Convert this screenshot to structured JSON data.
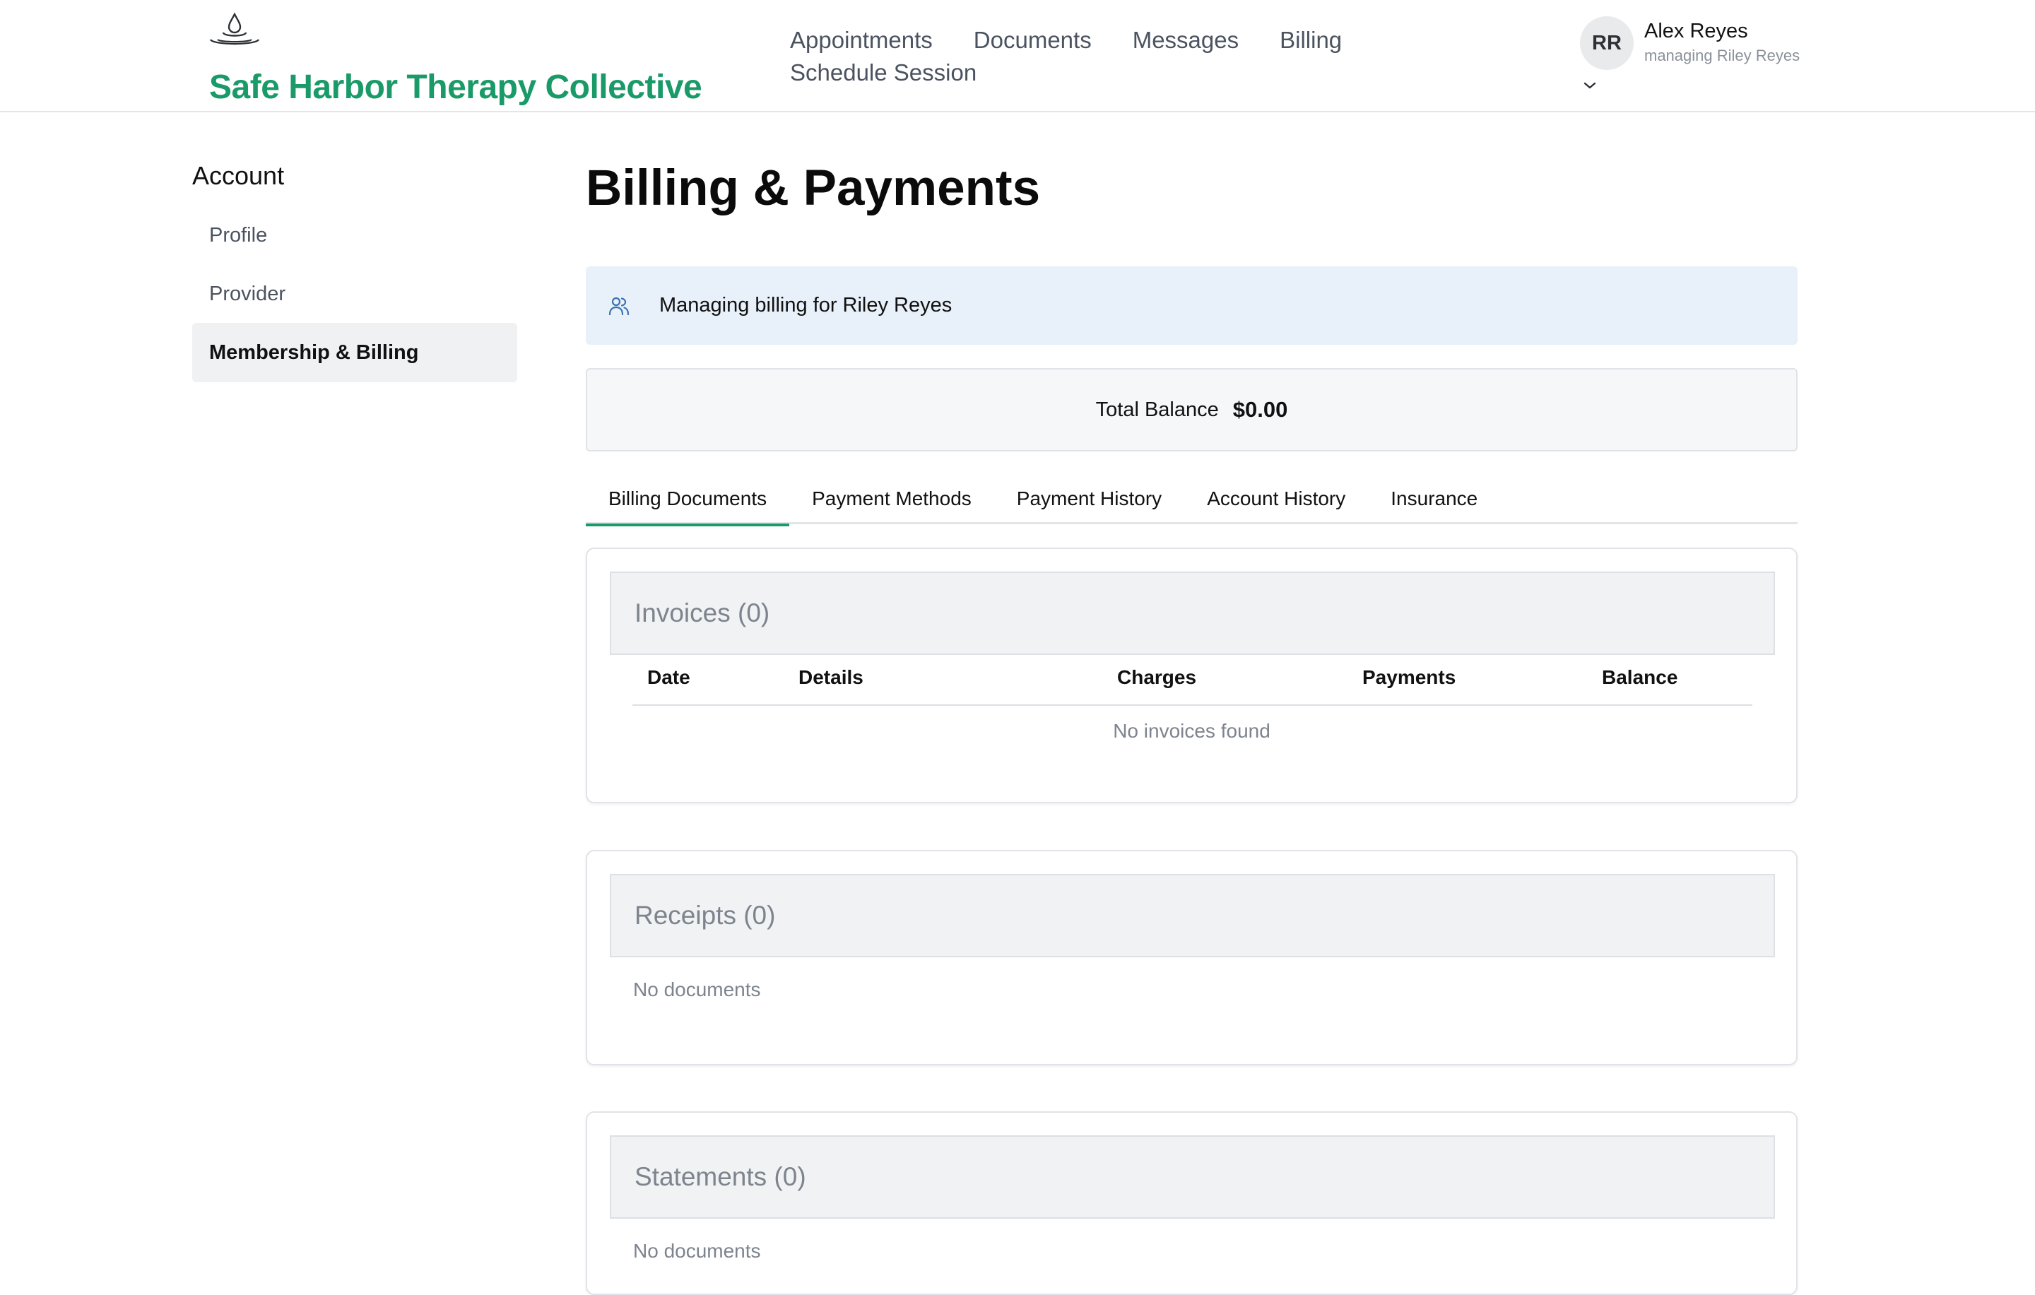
{
  "header": {
    "brand": "Safe Harbor Therapy Collective",
    "logo_icon": "water-drop-ripple-icon",
    "nav": [
      {
        "label": "Appointments"
      },
      {
        "label": "Documents"
      },
      {
        "label": "Messages"
      },
      {
        "label": "Billing"
      },
      {
        "label": "Schedule Session"
      }
    ],
    "user": {
      "initials": "RR",
      "name": "Alex Reyes",
      "subtitle": "managing Riley Reyes",
      "menu_icon": "chevron-down-icon"
    }
  },
  "sidebar": {
    "title": "Account",
    "items": [
      {
        "label": "Profile",
        "active": false
      },
      {
        "label": "Provider",
        "active": false
      },
      {
        "label": "Membership & Billing",
        "active": true
      }
    ]
  },
  "main": {
    "title": "Billing & Payments",
    "notice": {
      "icon": "users-icon",
      "text": "Managing billing for Riley Reyes"
    },
    "balance": {
      "label": "Total Balance",
      "value": "$0.00"
    },
    "tabs": [
      {
        "label": "Billing Documents",
        "active": true
      },
      {
        "label": "Payment Methods",
        "active": false
      },
      {
        "label": "Payment History",
        "active": false
      },
      {
        "label": "Account History",
        "active": false
      },
      {
        "label": "Insurance",
        "active": false
      }
    ],
    "invoices": {
      "title": "Invoices (0)",
      "columns": [
        "Date",
        "Details",
        "Charges",
        "Payments",
        "Balance"
      ],
      "empty": "No invoices found"
    },
    "receipts": {
      "title": "Receipts (0)",
      "empty": "No documents"
    },
    "statements": {
      "title": "Statements (0)",
      "empty": "No documents"
    }
  },
  "colors": {
    "brand": "#1a9a68",
    "notice_bg": "#e8f0f9",
    "active_tab_underline": "#1a9a68"
  }
}
